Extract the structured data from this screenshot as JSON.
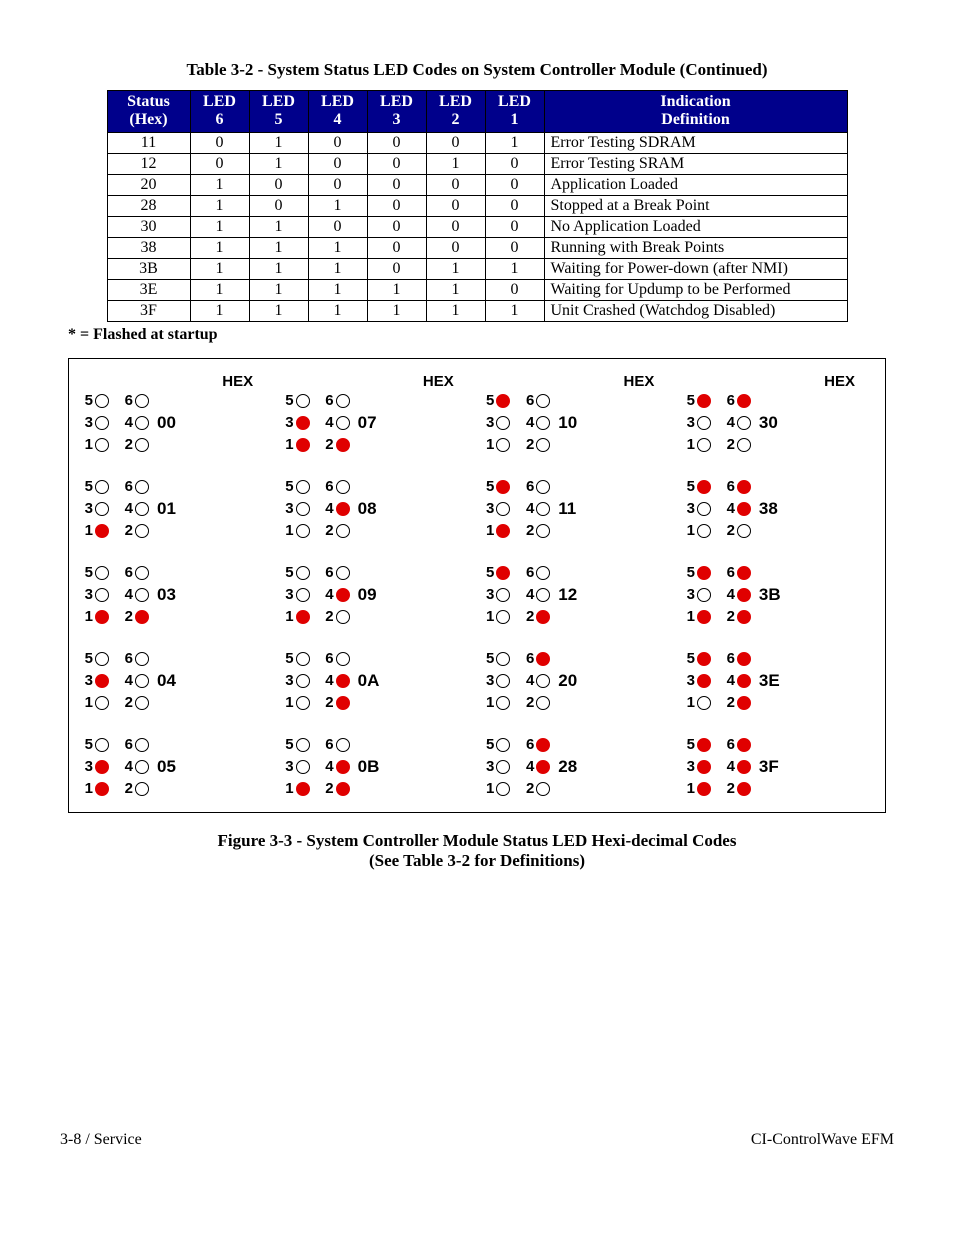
{
  "title": "Table 3-2 - System Status LED Codes on System Controller Module (Continued)",
  "headers": [
    "Status\n(Hex)",
    "LED\n6",
    "LED\n5",
    "LED\n4",
    "LED\n3",
    "LED\n2",
    "LED\n1",
    "Indication\nDefinition"
  ],
  "rows": [
    {
      "hex": "11",
      "l6": "0",
      "l5": "1",
      "l4": "0",
      "l3": "0",
      "l2": "0",
      "l1": "1",
      "def": "Error Testing SDRAM"
    },
    {
      "hex": "12",
      "l6": "0",
      "l5": "1",
      "l4": "0",
      "l3": "0",
      "l2": "1",
      "l1": "0",
      "def": "Error Testing SRAM"
    },
    {
      "hex": "20",
      "l6": "1",
      "l5": "0",
      "l4": "0",
      "l3": "0",
      "l2": "0",
      "l1": "0",
      "def": "Application Loaded"
    },
    {
      "hex": "28",
      "l6": "1",
      "l5": "0",
      "l4": "1",
      "l3": "0",
      "l2": "0",
      "l1": "0",
      "def": "Stopped at a Break Point"
    },
    {
      "hex": "30",
      "l6": "1",
      "l5": "1",
      "l4": "0",
      "l3": "0",
      "l2": "0",
      "l1": "0",
      "def": "No Application Loaded"
    },
    {
      "hex": "38",
      "l6": "1",
      "l5": "1",
      "l4": "1",
      "l3": "0",
      "l2": "0",
      "l1": "0",
      "def": "Running with Break Points"
    },
    {
      "hex": "3B",
      "l6": "1",
      "l5": "1",
      "l4": "1",
      "l3": "0",
      "l2": "1",
      "l1": "1",
      "def": "Waiting for Power-down (after NMI)"
    },
    {
      "hex": "3E",
      "l6": "1",
      "l5": "1",
      "l4": "1",
      "l3": "1",
      "l2": "1",
      "l1": "0",
      "def": "Waiting for Updump to be Performed"
    },
    {
      "hex": "3F",
      "l6": "1",
      "l5": "1",
      "l4": "1",
      "l3": "1",
      "l2": "1",
      "l1": "1",
      "def": "Unit Crashed (Watchdog Disabled)"
    }
  ],
  "footnote": "* = Flashed at startup",
  "hex_heading": "HEX",
  "led_numbers": [
    "5",
    "6",
    "3",
    "4",
    "1",
    "2"
  ],
  "chart_data": {
    "type": "table",
    "title": "System Controller Module Status LED Hexi-decimal Codes",
    "note": "LED positions: row0=[5,6], row1=[3,4], row2=[1,2]; bit value 1 = red (on), 0 = open (off). Grid is 4 columns × 5 rows of hex patterns, column-major.",
    "columns": [
      [
        {
          "hex": "00",
          "leds": {
            "5": 0,
            "6": 0,
            "3": 0,
            "4": 0,
            "1": 0,
            "2": 0
          }
        },
        {
          "hex": "01",
          "leds": {
            "5": 0,
            "6": 0,
            "3": 0,
            "4": 0,
            "1": 1,
            "2": 0
          }
        },
        {
          "hex": "03",
          "leds": {
            "5": 0,
            "6": 0,
            "3": 0,
            "4": 0,
            "1": 1,
            "2": 1
          }
        },
        {
          "hex": "04",
          "leds": {
            "5": 0,
            "6": 0,
            "3": 1,
            "4": 0,
            "1": 0,
            "2": 0
          }
        },
        {
          "hex": "05",
          "leds": {
            "5": 0,
            "6": 0,
            "3": 1,
            "4": 0,
            "1": 1,
            "2": 0
          }
        }
      ],
      [
        {
          "hex": "07",
          "leds": {
            "5": 0,
            "6": 0,
            "3": 1,
            "4": 0,
            "1": 1,
            "2": 1
          }
        },
        {
          "hex": "08",
          "leds": {
            "5": 0,
            "6": 0,
            "3": 0,
            "4": 1,
            "1": 0,
            "2": 0
          }
        },
        {
          "hex": "09",
          "leds": {
            "5": 0,
            "6": 0,
            "3": 0,
            "4": 1,
            "1": 1,
            "2": 0
          }
        },
        {
          "hex": "0A",
          "leds": {
            "5": 0,
            "6": 0,
            "3": 0,
            "4": 1,
            "1": 0,
            "2": 1
          }
        },
        {
          "hex": "0B",
          "leds": {
            "5": 0,
            "6": 0,
            "3": 0,
            "4": 1,
            "1": 1,
            "2": 1
          }
        }
      ],
      [
        {
          "hex": "10",
          "leds": {
            "5": 1,
            "6": 0,
            "3": 0,
            "4": 0,
            "1": 0,
            "2": 0
          }
        },
        {
          "hex": "11",
          "leds": {
            "5": 1,
            "6": 0,
            "3": 0,
            "4": 0,
            "1": 1,
            "2": 0
          }
        },
        {
          "hex": "12",
          "leds": {
            "5": 1,
            "6": 0,
            "3": 0,
            "4": 0,
            "1": 0,
            "2": 1
          }
        },
        {
          "hex": "20",
          "leds": {
            "5": 0,
            "6": 1,
            "3": 0,
            "4": 0,
            "1": 0,
            "2": 0
          }
        },
        {
          "hex": "28",
          "leds": {
            "5": 0,
            "6": 1,
            "3": 0,
            "4": 1,
            "1": 0,
            "2": 0
          }
        }
      ],
      [
        {
          "hex": "30",
          "leds": {
            "5": 1,
            "6": 1,
            "3": 0,
            "4": 0,
            "1": 0,
            "2": 0
          }
        },
        {
          "hex": "38",
          "leds": {
            "5": 1,
            "6": 1,
            "3": 0,
            "4": 1,
            "1": 0,
            "2": 0
          }
        },
        {
          "hex": "3B",
          "leds": {
            "5": 1,
            "6": 1,
            "3": 0,
            "4": 1,
            "1": 1,
            "2": 1
          }
        },
        {
          "hex": "3E",
          "leds": {
            "5": 1,
            "6": 1,
            "3": 1,
            "4": 1,
            "1": 0,
            "2": 1
          }
        },
        {
          "hex": "3F",
          "leds": {
            "5": 1,
            "6": 1,
            "3": 1,
            "4": 1,
            "1": 1,
            "2": 1
          }
        }
      ]
    ]
  },
  "figure_caption_line1": "Figure 3-3 - System Controller Module Status LED Hexi-decimal Codes",
  "figure_caption_line2": "(See Table 3-2 for Definitions)",
  "footer_left": "3-8 / Service",
  "footer_right": "CI-ControlWave EFM"
}
